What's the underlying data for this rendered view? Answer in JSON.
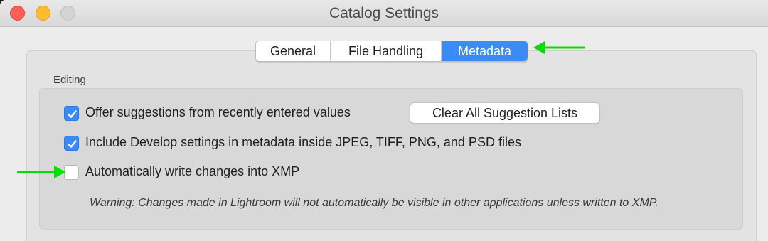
{
  "window": {
    "title": "Catalog Settings",
    "controls": [
      "close-button",
      "minimize-button",
      "zoom-button"
    ]
  },
  "tabs": [
    {
      "label": "General",
      "selected": false
    },
    {
      "label": "File Handling",
      "selected": false
    },
    {
      "label": "Metadata",
      "selected": true
    }
  ],
  "editing": {
    "section_label": "Editing",
    "options": [
      {
        "label": "Offer suggestions from recently entered values",
        "checked": true
      },
      {
        "label": "Include Develop settings in metadata inside JPEG, TIFF, PNG, and PSD files",
        "checked": true
      },
      {
        "label": "Automatically write changes into XMP",
        "checked": false
      }
    ],
    "clear_button_label": "Clear All Suggestion Lists",
    "warning": "Warning: Changes made in Lightroom will not automatically be visible in other applications unless written to XMP."
  },
  "annotations": {
    "arrow_color": "#00e000"
  },
  "colors": {
    "accent": "#3a8bf6",
    "close": "#fe5f57",
    "minimize": "#febc2e"
  }
}
